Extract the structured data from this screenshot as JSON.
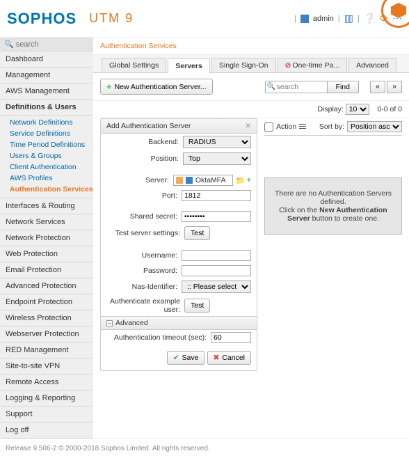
{
  "header": {
    "logo": "SOPHOS",
    "product": "UTM 9",
    "user": "admin"
  },
  "sidebar": {
    "search_placeholder": "search",
    "items": [
      "Dashboard",
      "Management",
      "AWS Management",
      "Definitions & Users",
      "Interfaces & Routing",
      "Network Services",
      "Network Protection",
      "Web Protection",
      "Email Protection",
      "Advanced Protection",
      "Endpoint Protection",
      "Wireless Protection",
      "Webserver Protection",
      "RED Management",
      "Site-to-site VPN",
      "Remote Access",
      "Logging & Reporting",
      "Support",
      "Log off"
    ],
    "definitions_sub": [
      "Network Definitions",
      "Service Definitions",
      "Time Period Definitions",
      "Users & Groups",
      "Client Authentication",
      "AWS Profiles",
      "Authentication Services"
    ]
  },
  "breadcrumb": "Authentication Services",
  "tabs": [
    "Global Settings",
    "Servers",
    "Single Sign-On",
    "One-time Pa...",
    "Advanced"
  ],
  "toolbar": {
    "new_btn": "New Authentication Server...",
    "search_placeholder": "search",
    "find_btn": "Find"
  },
  "display": {
    "label": "Display:",
    "value": "10",
    "count": "0-0 of 0"
  },
  "panel": {
    "title": "Add Authentication Server",
    "labels": {
      "backend": "Backend:",
      "position": "Position:",
      "server": "Server:",
      "port": "Port:",
      "shared_secret": "Shared secret:",
      "test_settings": "Test server settings:",
      "username": "Username:",
      "password": "Password:",
      "nas": "Nas-Identifier:",
      "auth_user": "Authenticate example user:",
      "advanced": "Advanced",
      "timeout": "Authentication timeout (sec):"
    },
    "values": {
      "backend": "RADIUS",
      "position": "Top",
      "server_name": "OktaMFA",
      "port": "1812",
      "shared_secret": "••••••••",
      "nas_placeholder": ":: Please select ::",
      "timeout": "60",
      "test_btn": "Test",
      "save": "Save",
      "cancel": "Cancel"
    }
  },
  "list": {
    "action": "Action",
    "sortby": "Sort by:",
    "sort_value": "Position asc",
    "empty1": "There are no Authentication Servers defined.",
    "empty2_a": "Click on the ",
    "empty2_b": "New Authentication Server",
    "empty2_c": " button to create one."
  },
  "footer": "Release 9.506-2  © 2000-2018 Sophos Limited. All rights reserved."
}
